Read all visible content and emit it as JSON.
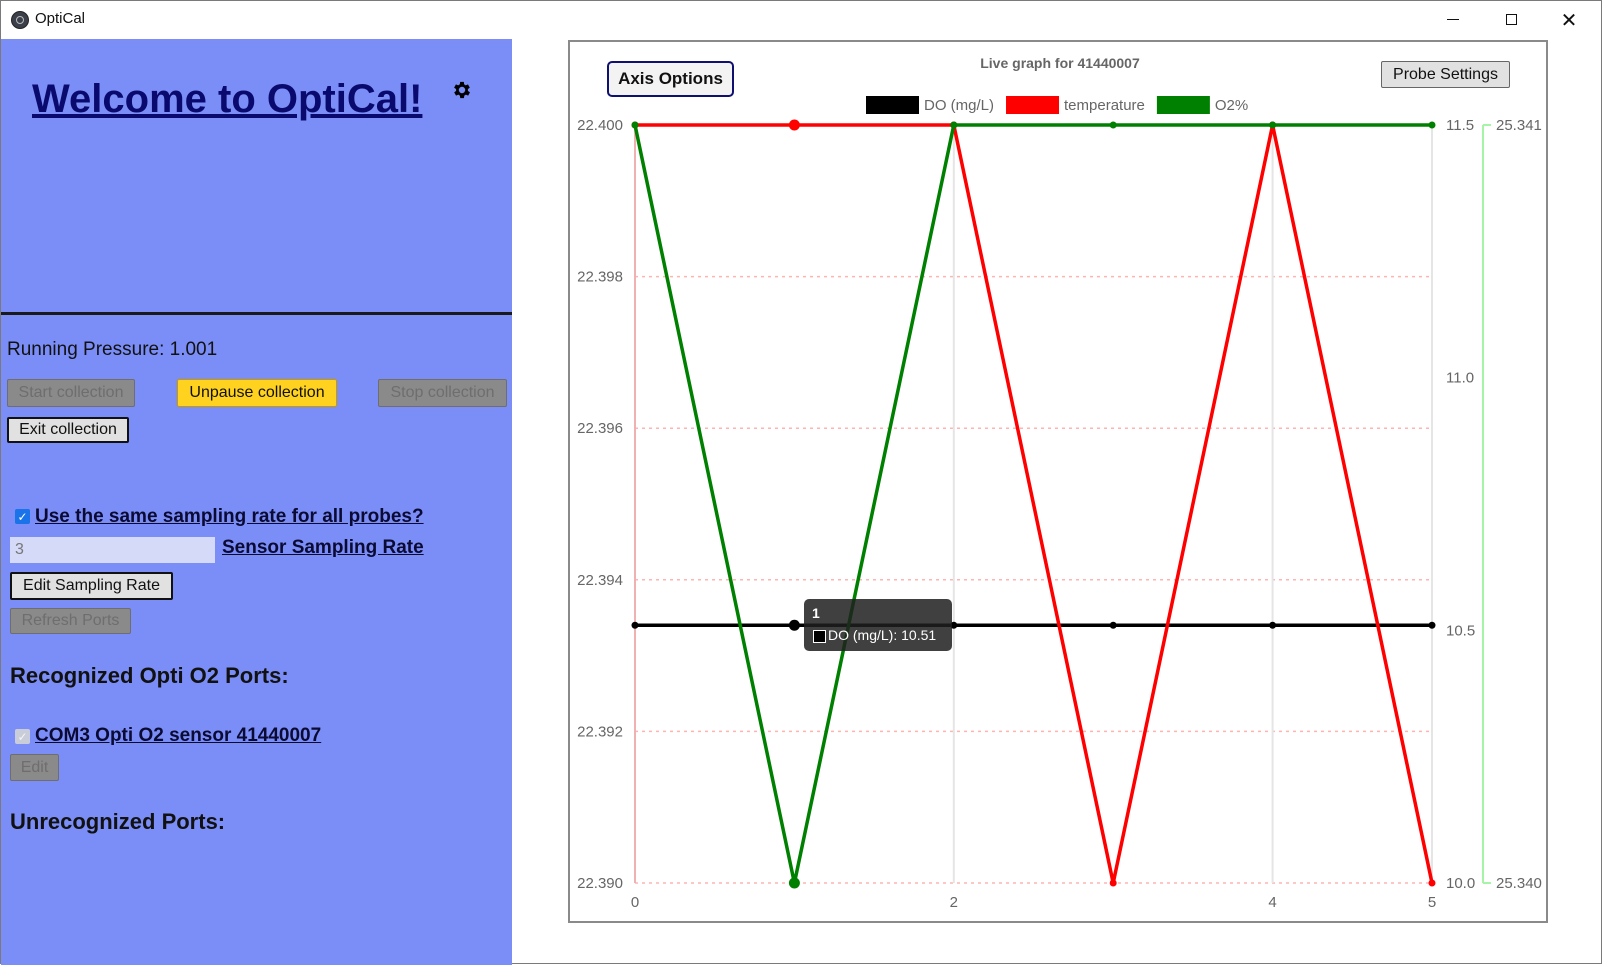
{
  "window": {
    "title": "OptiCal",
    "minimize": "minimize-icon",
    "maximize": "maximize-icon",
    "close": "✕"
  },
  "sidebar": {
    "welcome": "Welcome to OptiCal!",
    "settings_icon": "gear-icon",
    "running_pressure": "Running Pressure: 1.001",
    "start_label": "Start collection",
    "unpause_label": "Unpause collection",
    "stop_label": "Stop collection",
    "exit_label": "Exit collection",
    "same_rate_checked": true,
    "same_rate_label": "Use the same sampling rate for all probes?",
    "rate_value": "3",
    "rate_label": "Sensor Sampling Rate",
    "edit_rate_label": "Edit Sampling Rate",
    "refresh_label": "Refresh Ports",
    "recognized_heading": "Recognized Opti O2 Ports:",
    "port_label": "COM3 Opti O2 sensor 41440007",
    "port_checked": true,
    "edit_port_label": "Edit",
    "unrecognized_heading": "Unrecognized Ports:"
  },
  "chart_header": {
    "axis_options_label": "Axis Options",
    "probe_settings_label": "Probe Settings"
  },
  "tooltip": {
    "title": "1",
    "body": "DO (mg/L): 10.51"
  },
  "chart_data": {
    "type": "line",
    "title": "Live graph for 41440007",
    "x": [
      0,
      1,
      2,
      3,
      4,
      5
    ],
    "x_ticks": [
      "0",
      "2",
      "4",
      "5"
    ],
    "legend_position": "top",
    "series": [
      {
        "name": "DO (mg/L)",
        "color": "#000000",
        "axis": "do",
        "values": [
          10.51,
          10.51,
          10.51,
          10.51,
          10.51,
          10.51
        ]
      },
      {
        "name": "temperature",
        "color": "#ff0000",
        "axis": "temp",
        "values": [
          22.4,
          22.4,
          22.4,
          22.39,
          22.4,
          22.39
        ]
      },
      {
        "name": "O2%",
        "color": "#008000",
        "axis": "o2",
        "values": [
          25.341,
          25.34,
          25.341,
          25.341,
          25.341,
          25.341
        ]
      }
    ],
    "axes": {
      "temp": {
        "side": "left",
        "ylim": [
          22.39,
          22.4
        ],
        "ticks": [
          "22.400",
          "22.398",
          "22.396",
          "22.394",
          "22.392",
          "22.390"
        ],
        "grid": true,
        "grid_color": "#ffb3b3"
      },
      "do": {
        "side": "right",
        "ylim": [
          10.0,
          11.5
        ],
        "ticks": [
          "11.5",
          "11.0",
          "10.5",
          "10.0"
        ]
      },
      "o2": {
        "side": "right",
        "ylim": [
          25.34,
          25.341
        ],
        "ticks": [
          "25.341",
          "25.340"
        ],
        "axis_color": "#a6f5a6"
      }
    }
  }
}
